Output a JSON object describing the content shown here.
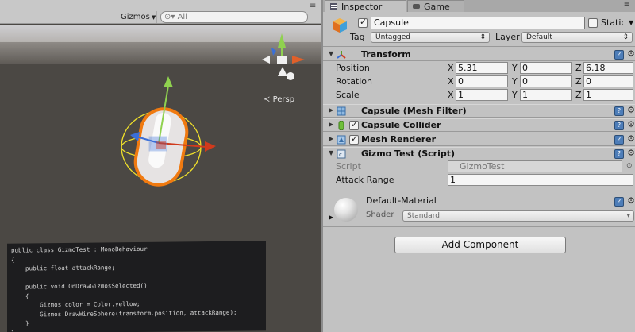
{
  "scene": {
    "gizmos_label": "Gizmos",
    "search_placeholder": "All",
    "persp_label": "Persp",
    "code_lines": [
      "public class GizmoTest : MonoBehaviour",
      "{",
      "    public float attackRange;",
      "",
      "    public void OnDrawGizmosSelected()",
      "    {",
      "        Gizmos.color = Color.yellow;",
      "        Gizmos.DrawWireSphere(transform.position, attackRange);",
      "    }",
      "}"
    ]
  },
  "tabs": {
    "inspector": "Inspector",
    "game": "Game"
  },
  "header": {
    "name": "Capsule",
    "static_label": "Static",
    "tag_label": "Tag",
    "tag_value": "Untagged",
    "layer_label": "Layer",
    "layer_value": "Default"
  },
  "transform": {
    "title": "Transform",
    "position_label": "Position",
    "rotation_label": "Rotation",
    "scale_label": "Scale",
    "axis_x": "X",
    "axis_y": "Y",
    "axis_z": "Z",
    "position": {
      "x": "5.31",
      "y": "0",
      "z": "6.18"
    },
    "rotation": {
      "x": "0",
      "y": "0",
      "z": "0"
    },
    "scale": {
      "x": "1",
      "y": "1",
      "z": "1"
    }
  },
  "components": {
    "mesh_filter": "Capsule (Mesh Filter)",
    "collider": "Capsule Collider",
    "renderer": "Mesh Renderer",
    "script_title": "Gizmo Test (Script)"
  },
  "script": {
    "script_label": "Script",
    "script_value": "GizmoTest",
    "range_label": "Attack Range",
    "range_value": "1"
  },
  "material": {
    "name": "Default-Material",
    "shader_label": "Shader",
    "shader_value": "Standard"
  },
  "add_component_label": "Add Component",
  "colors": {
    "help_blue": "#4d7db8",
    "gizmo_yellow": "#f0e02a",
    "selection_orange": "#f07a10"
  }
}
